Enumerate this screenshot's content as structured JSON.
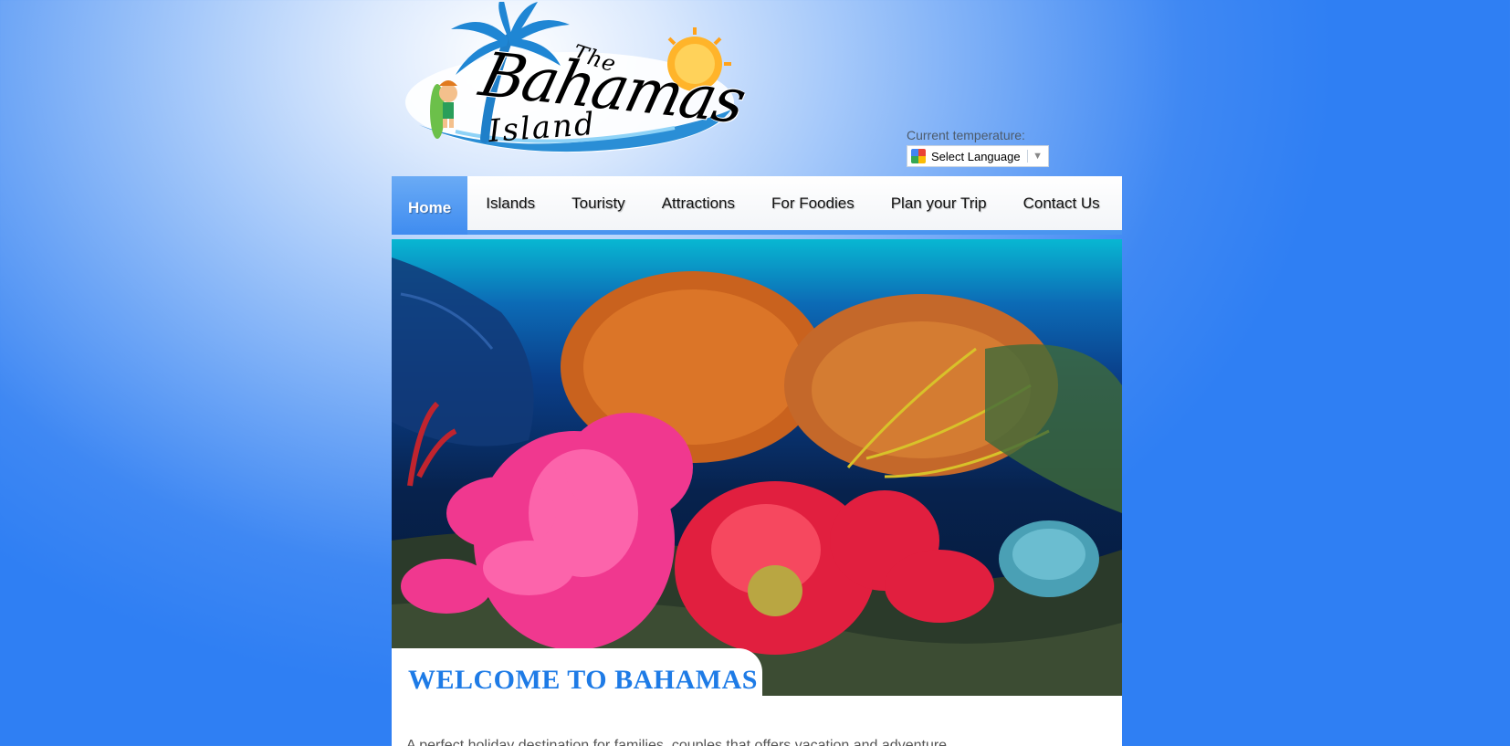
{
  "logo": {
    "the": "The",
    "bahamas": "Bahamas",
    "island": "Island",
    "icons": [
      "palm-tree-icon",
      "sun-icon",
      "surfer-kid-icon"
    ]
  },
  "header": {
    "temperature_label": "Current temperature:",
    "language_select": {
      "label": "Select Language",
      "icon": "google-translate-icon"
    }
  },
  "nav": {
    "items": [
      {
        "label": "Home",
        "active": true
      },
      {
        "label": "Islands"
      },
      {
        "label": "Touristy"
      },
      {
        "label": "Attractions"
      },
      {
        "label": "For Foodies"
      },
      {
        "label": "Plan your Trip"
      },
      {
        "label": "Contact Us"
      }
    ]
  },
  "main": {
    "welcome_title": "WELCOME TO BAHAMAS",
    "intro_text": "A perfect holiday destination for families, couples that offers vacation and adventure"
  },
  "colors": {
    "accent": "#4a95f0",
    "heading": "#1e7be6",
    "background": "#3f88f3"
  }
}
